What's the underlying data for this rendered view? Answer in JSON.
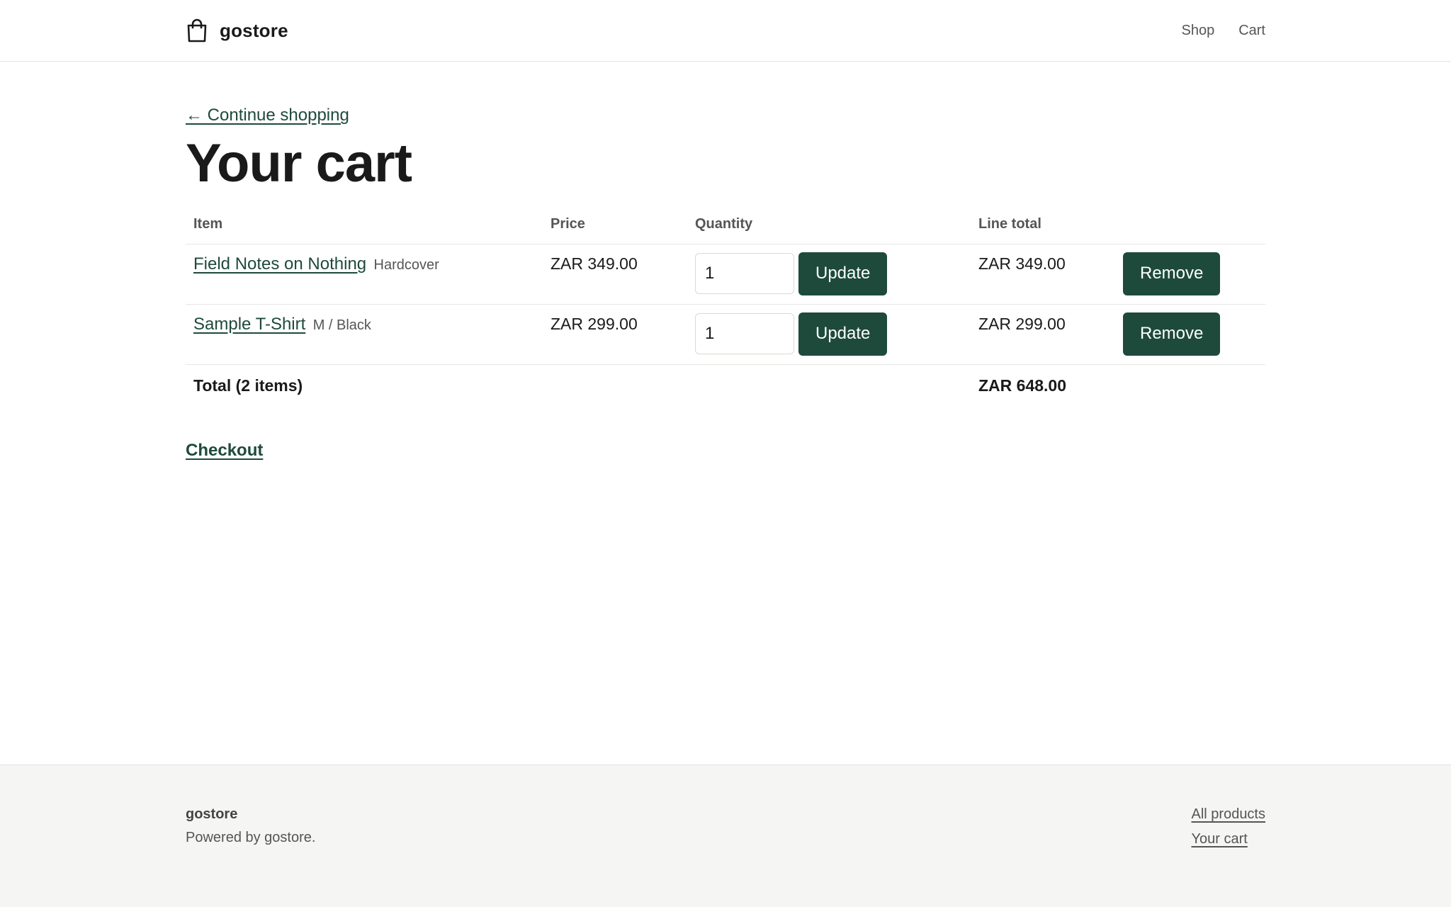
{
  "header": {
    "brand": "gostore",
    "nav": [
      {
        "label": "Shop"
      },
      {
        "label": "Cart"
      }
    ]
  },
  "main": {
    "back_link": "← Continue shopping",
    "title": "Your cart",
    "columns": {
      "item": "Item",
      "price": "Price",
      "quantity": "Quantity",
      "line_total": "Line total"
    },
    "items": [
      {
        "name": "Field Notes on Nothing",
        "variant": "Hardcover",
        "price": "ZAR 349.00",
        "quantity": "1",
        "update_label": "Update",
        "line_total": "ZAR 349.00",
        "remove_label": "Remove"
      },
      {
        "name": "Sample T-Shirt",
        "variant": "M / Black",
        "price": "ZAR 299.00",
        "quantity": "1",
        "update_label": "Update",
        "line_total": "ZAR 299.00",
        "remove_label": "Remove"
      }
    ],
    "total_label": "Total (2 items)",
    "total_value": "ZAR 648.00",
    "checkout_label": "Checkout"
  },
  "footer": {
    "brand": "gostore",
    "tagline": "Powered by gostore.",
    "links": [
      {
        "label": "All products"
      },
      {
        "label": "Your cart"
      }
    ]
  },
  "colors": {
    "accent": "#1e4a3c",
    "footer_bg": "#f5f5f3"
  },
  "icons": {
    "brand": "shopping-bag-icon"
  }
}
